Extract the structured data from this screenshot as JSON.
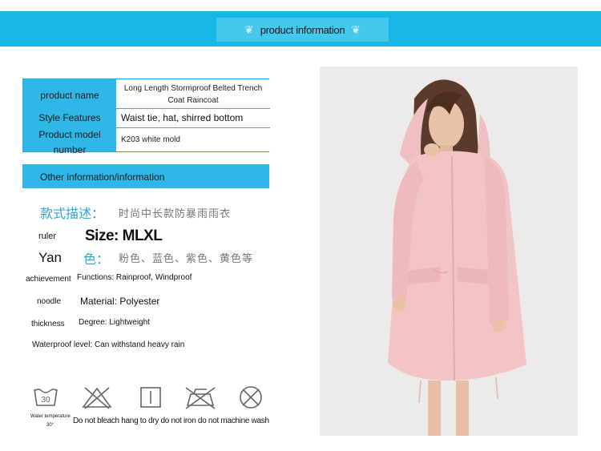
{
  "banner": {
    "title": "product information"
  },
  "product": {
    "name_label": "product name",
    "name_value_line1": "Long Length Stormproof Belted Trench",
    "name_value_line2": "Coat Raincoat",
    "features_label": "Style Features",
    "features_value": "Waist tie, hat, shirred bottom",
    "model_label_line1": "Product model",
    "model_label_line2": "number",
    "model_value": "K203 white mold"
  },
  "section": {
    "title": "Other information/information"
  },
  "details": {
    "style_desc_label": "款式描述：",
    "style_desc_value": "时尚中长款防暴雨雨衣",
    "ruler_label": "ruler",
    "size_value": "Size: MLXL",
    "yan_label": "Yan",
    "color_label": "色：",
    "color_value": "粉色、蓝色、紫色、黄色等",
    "achievement_label": "achievement",
    "functions_value": "Functions: Rainproof, Windproof",
    "noodle_label": "noodle",
    "material_value": "Material: Polyester",
    "thickness_label": "thickness",
    "degree_value": "Degree: Lightweight",
    "waterproof_value": "Waterproof level: Can withstand heavy rain"
  },
  "care": {
    "wash_number": "30",
    "temp_line1": "Water temperature",
    "temp_line2": "30°",
    "instructions": "Do not bleach hang to dry do not iron do not machine wash"
  },
  "colors": {
    "banner": "#18b8e6",
    "table_label_bg": "#2fb7e8",
    "chinese_label": "#2fa6d6",
    "coat": "#f2c4c6"
  }
}
